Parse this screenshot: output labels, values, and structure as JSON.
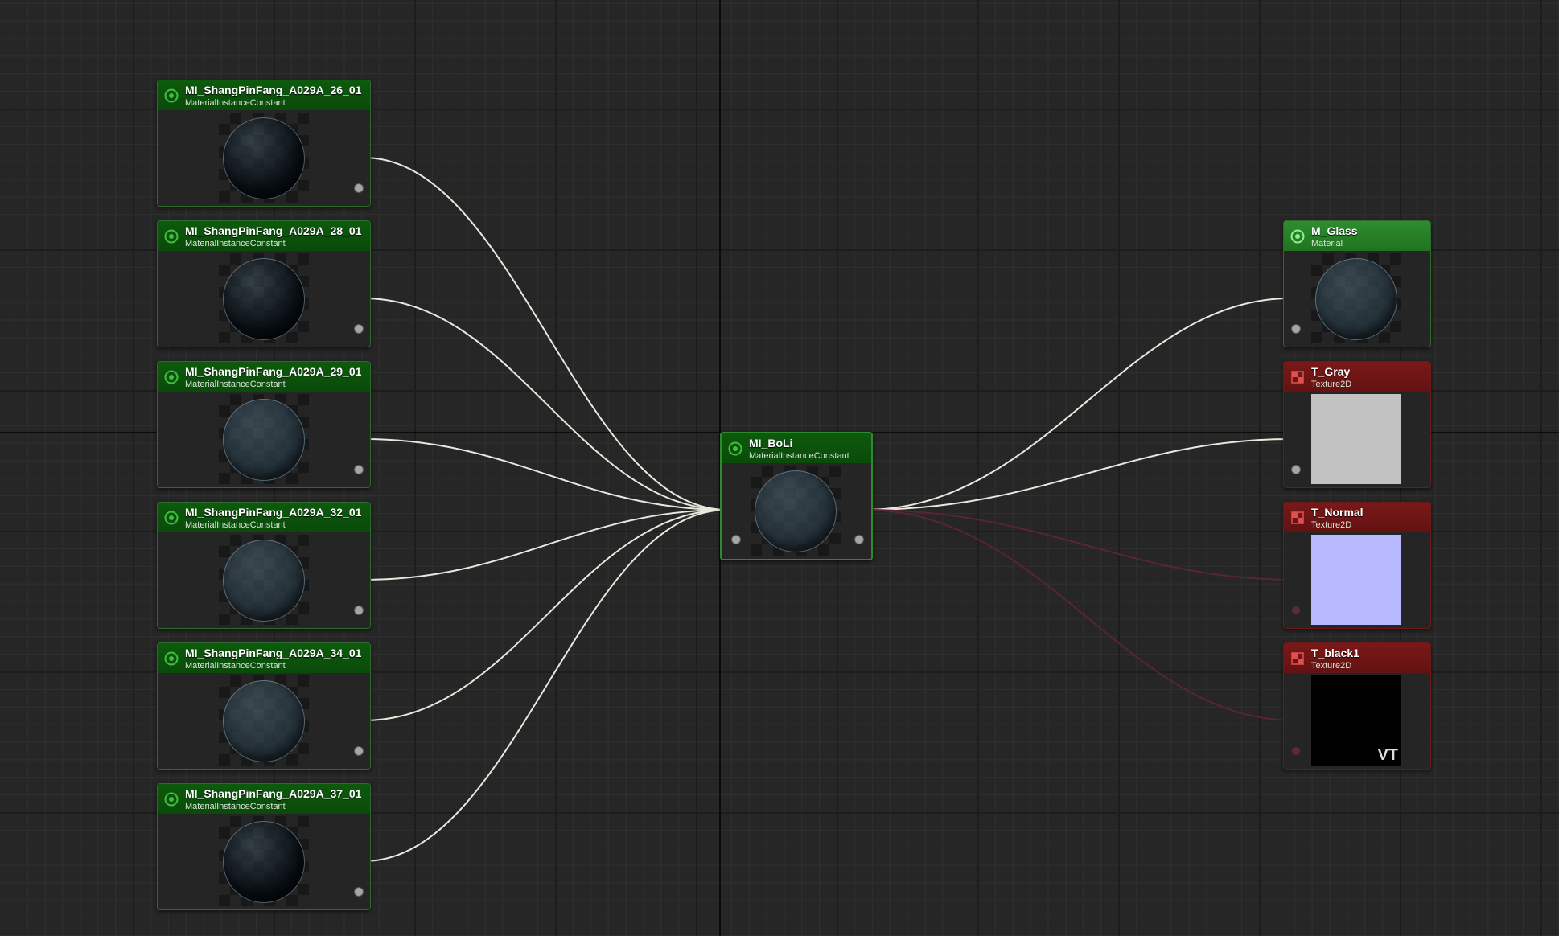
{
  "canvas": {
    "grid_color": "#303030",
    "wire_color": "#e8e8dc",
    "faint_wire_color": "#5a2438"
  },
  "colors": {
    "material_instance_header": "#0b560b",
    "material_header": "#2a862a",
    "texture_header": "#701515"
  },
  "nodes": {
    "mi_26": {
      "title": "MI_ShangPinFang_A029A_26_01",
      "type": "MaterialInstanceConstant",
      "icon": "material-instance-icon"
    },
    "mi_28": {
      "title": "MI_ShangPinFang_A029A_28_01",
      "type": "MaterialInstanceConstant",
      "icon": "material-instance-icon"
    },
    "mi_29": {
      "title": "MI_ShangPinFang_A029A_29_01",
      "type": "MaterialInstanceConstant",
      "icon": "material-instance-icon"
    },
    "mi_32": {
      "title": "MI_ShangPinFang_A029A_32_01",
      "type": "MaterialInstanceConstant",
      "icon": "material-instance-icon"
    },
    "mi_34": {
      "title": "MI_ShangPinFang_A029A_34_01",
      "type": "MaterialInstanceConstant",
      "icon": "material-instance-icon"
    },
    "mi_37": {
      "title": "MI_ShangPinFang_A029A_37_01",
      "type": "MaterialInstanceConstant",
      "icon": "material-instance-icon"
    },
    "mi_boli": {
      "title": "MI_BoLi",
      "type": "MaterialInstanceConstant",
      "icon": "material-instance-icon"
    },
    "m_glass": {
      "title": "M_Glass",
      "type": "Material",
      "icon": "material-icon"
    },
    "t_gray": {
      "title": "T_Gray",
      "type": "Texture2D",
      "icon": "texture-icon",
      "swatch": "#c2c2c2"
    },
    "t_normal": {
      "title": "T_Normal",
      "type": "Texture2D",
      "icon": "texture-icon",
      "swatch": "#b9b9ff"
    },
    "t_black1": {
      "title": "T_black1",
      "type": "Texture2D",
      "icon": "texture-icon",
      "swatch": "#000000",
      "badge": "VT"
    }
  }
}
